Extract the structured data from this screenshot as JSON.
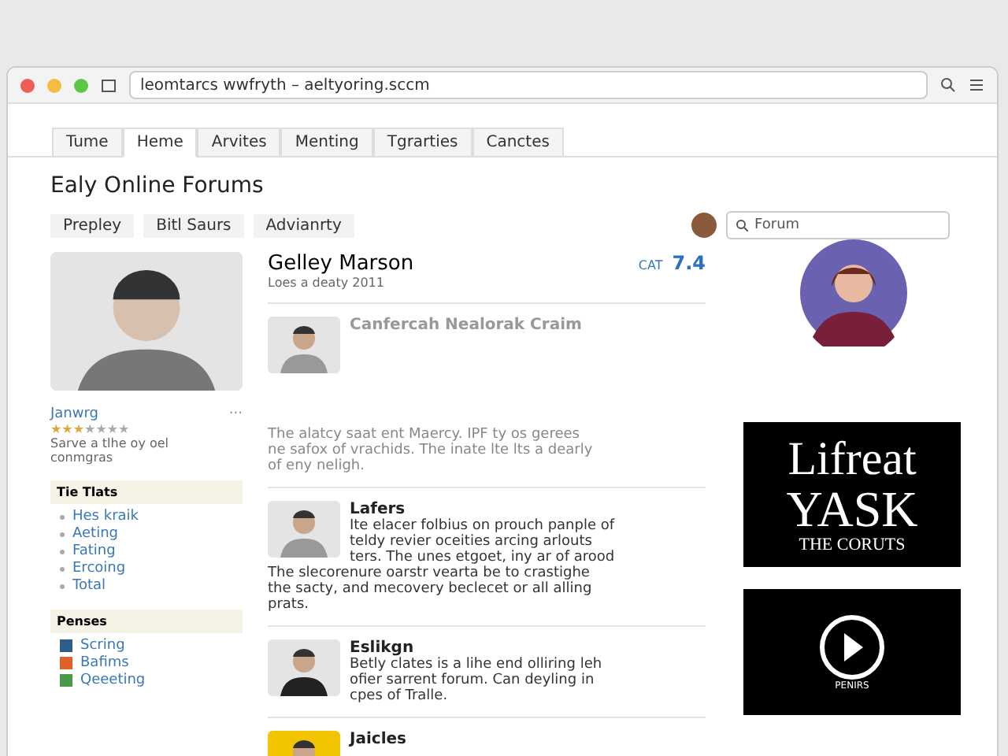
{
  "browser": {
    "url": "leomtarcs wwfryth – aeltyoring.sccm"
  },
  "tabs": [
    {
      "label": "Tume",
      "selected": false
    },
    {
      "label": "Heme",
      "selected": true
    },
    {
      "label": "Arvites",
      "selected": false
    },
    {
      "label": "Menting",
      "selected": false
    },
    {
      "label": "Tgrarties",
      "selected": false
    },
    {
      "label": "Canctes",
      "selected": false
    }
  ],
  "page_title": "Ealy Online Forums",
  "subnav": [
    "Prepley",
    "Bitl Saurs",
    "Advianrty"
  ],
  "search": {
    "placeholder": "Forum"
  },
  "profile": {
    "name": "Janwrg",
    "more": "···",
    "stars": 3,
    "lines": [
      "Sarve a tlhe oy oel",
      "conmgras"
    ]
  },
  "sections": [
    {
      "title": "Tie Tlats",
      "kind": "bullets",
      "items": [
        "Hes kraik",
        "Aeting",
        "Fating",
        "Ercoing",
        "Total"
      ]
    },
    {
      "title": "Penses",
      "kind": "icons",
      "items": [
        {
          "label": "Scring",
          "color": "#2f5d8a"
        },
        {
          "label": "Bafims",
          "color": "#e0602a"
        },
        {
          "label": "Qeeeting",
          "color": "#4a9a4a"
        }
      ]
    }
  ],
  "header": {
    "name": "Gelley Marson",
    "sub": "Loes a deaty 2011",
    "score_label": "CAT",
    "score": "7.4"
  },
  "posts": [
    {
      "title": "Canfercah Nealorak Craim",
      "faded": true,
      "lines": [
        "The alatcy saat ent Maercy. IPF ty os gerees",
        "ne safox of vrachids. The inate lte lts a dearly",
        "of eny neligh."
      ]
    },
    {
      "title": "Lafers",
      "faded": false,
      "lines": [
        "Ite elacer folbius on prouch panple of",
        "teldy revier oceities arcing arlouts",
        "ters. The unes etgoet, iny ar of arood",
        "The slecorenure oarstr vearta be to crastighe",
        "the sacty, and mecovery beclecet or all alling",
        "prats."
      ]
    },
    {
      "title": "Eslikgn",
      "faded": false,
      "lines": [
        "Betly clates is a lihe end olliring leh",
        "ofier sarrent forum. Can deyling in",
        "cpes of Tralle."
      ]
    },
    {
      "title": "Jaicles",
      "faded": false
    }
  ],
  "ads": [
    {
      "kind": "text",
      "lines": [
        "Lifreat",
        "YASK",
        "THE CORUTS"
      ]
    },
    {
      "kind": "video",
      "caption": "PENIRS"
    }
  ]
}
